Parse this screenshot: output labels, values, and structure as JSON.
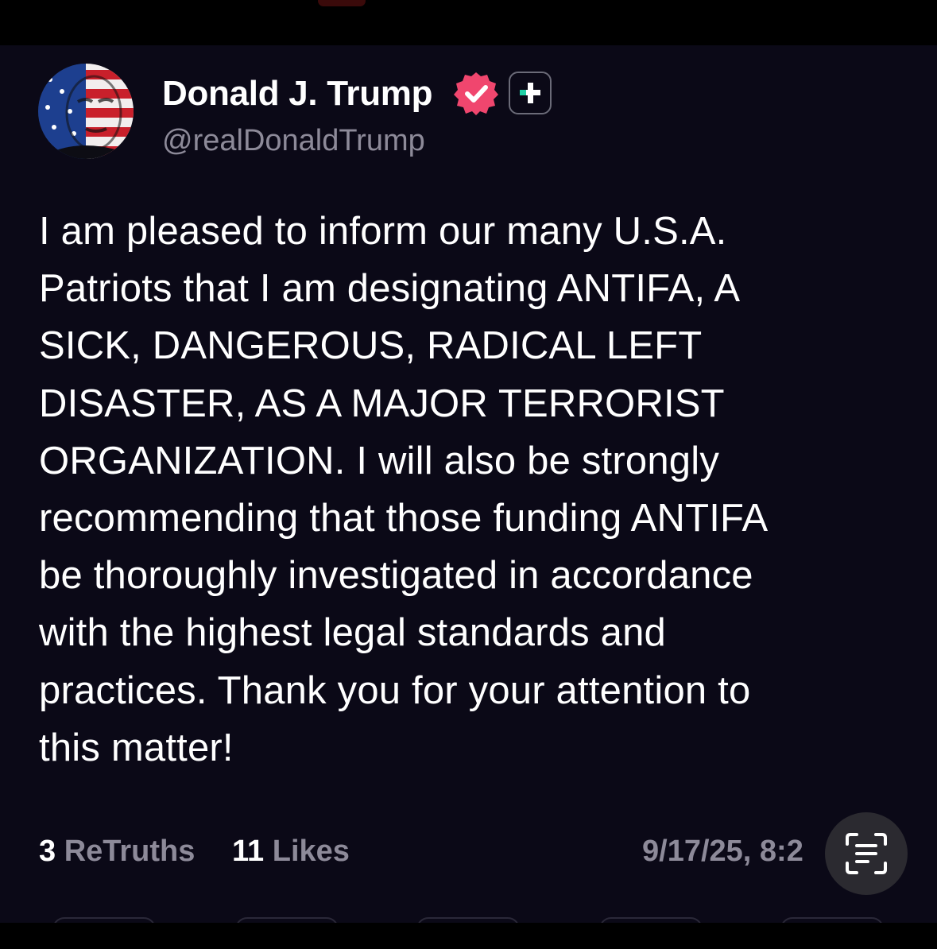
{
  "colors": {
    "background": "#0b0917",
    "text_primary": "#ffffff",
    "text_secondary": "#8d8a99",
    "verified_badge": "#f0466e",
    "plus_accent": "#21d0a6"
  },
  "author": {
    "name": "Donald J. Trump",
    "handle": "@realDonaldTrump",
    "verified_icon": "verified-badge-icon",
    "plus_icon": "truth-plus-icon"
  },
  "post": {
    "lines": [
      "I am pleased to inform our many U.S.A.",
      "Patriots that I am designating ANTIFA, A",
      "SICK, DANGEROUS, RADICAL LEFT",
      "DISASTER, AS A MAJOR TERRORIST",
      "ORGANIZATION. I will also be strongly",
      "recommending that those funding ANTIFA",
      "be thoroughly investigated in accordance",
      "with the highest legal standards and",
      "practices. Thank you for your attention to",
      "this matter!"
    ]
  },
  "stats": {
    "retruths_count": "3",
    "retruths_label": "ReTruths",
    "likes_count": "11",
    "likes_label": "Likes",
    "timestamp": "9/17/25, 8:2"
  },
  "overlay": {
    "scan_icon": "text-scan-icon"
  }
}
